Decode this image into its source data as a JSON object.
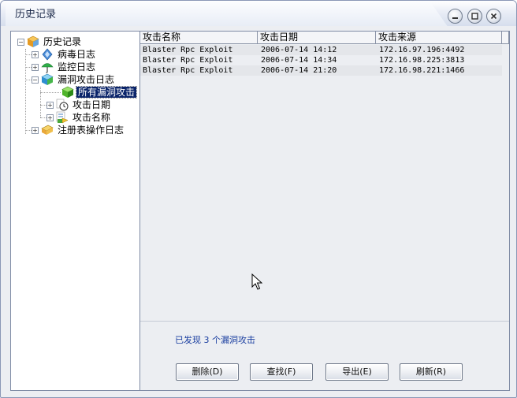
{
  "window": {
    "title": "历史记录"
  },
  "tree": {
    "root": {
      "label": "历史记录",
      "icon": "history-box-icon"
    },
    "items": [
      {
        "label": "病毒日志",
        "icon": "virus-shield-icon"
      },
      {
        "label": "监控日志",
        "icon": "umbrella-icon"
      },
      {
        "label": "漏洞攻击日志",
        "icon": "vulnerability-box-icon",
        "children": [
          {
            "label": "所有漏洞攻击",
            "icon": "green-box-icon",
            "selected": true
          },
          {
            "label": "攻击日期",
            "icon": "clock-icon"
          },
          {
            "label": "攻击名称",
            "icon": "name-list-icon"
          }
        ]
      },
      {
        "label": "注册表操作日志",
        "icon": "registry-book-icon"
      }
    ]
  },
  "table": {
    "columns": [
      "攻击名称",
      "攻击日期",
      "攻击来源"
    ],
    "rows": [
      [
        "Blaster Rpc Exploit",
        "2006-07-14 14:12",
        "172.16.97.196:4492"
      ],
      [
        "Blaster Rpc Exploit",
        "2006-07-14 14:34",
        "172.16.98.225:3813"
      ],
      [
        "Blaster Rpc Exploit",
        "2006-07-14 21:20",
        "172.16.98.221:1466"
      ]
    ]
  },
  "status": {
    "text": "已发现 3 个漏洞攻击"
  },
  "buttons": {
    "delete": "删除(D)",
    "find": "查找(F)",
    "export": "导出(E)",
    "refresh": "刷新(R)"
  },
  "colors": {
    "selection": "#0a246a",
    "status_text": "#1a3ea0",
    "title_text": "#1c2a4a"
  }
}
